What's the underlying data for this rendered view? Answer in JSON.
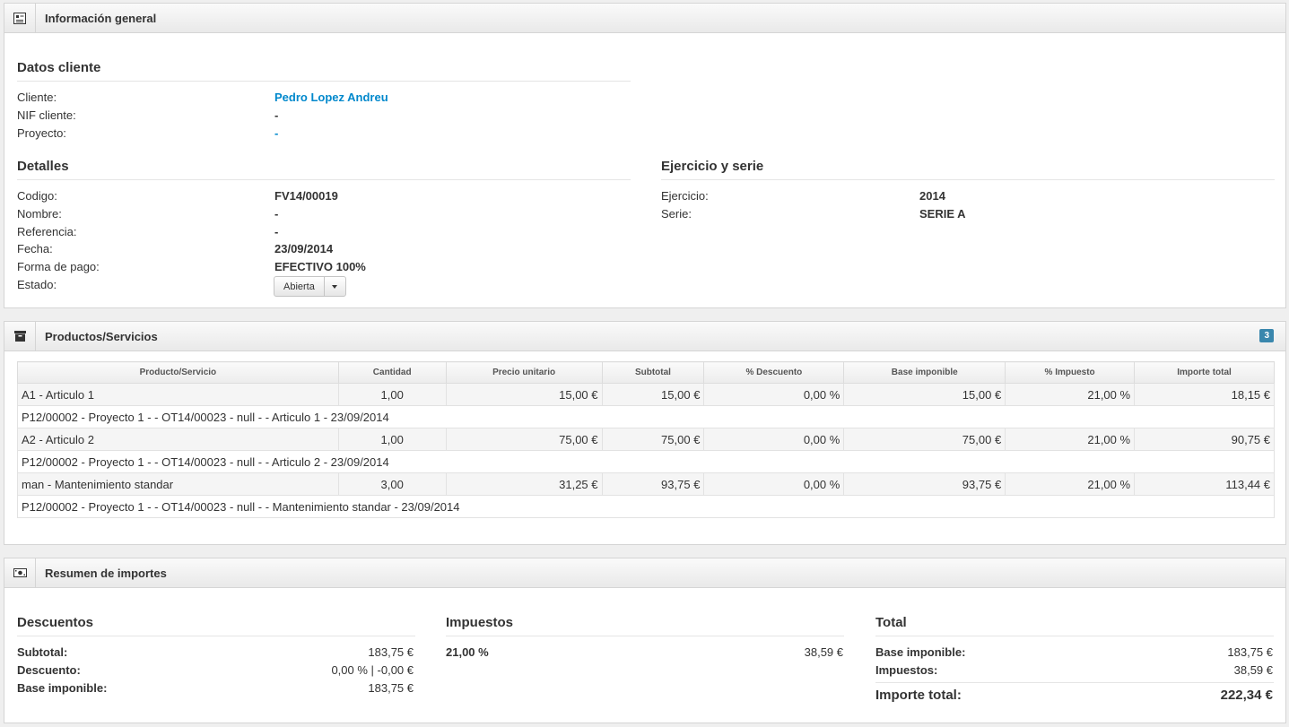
{
  "info": {
    "header": "Información general",
    "cliente_section": {
      "title": "Datos cliente",
      "rows": [
        {
          "label": "Cliente:",
          "value": "Pedro Lopez Andreu"
        },
        {
          "label": "NIF cliente:",
          "value": "-"
        },
        {
          "label": "Proyecto:",
          "value": "-"
        }
      ]
    },
    "detalles_section": {
      "title": "Detalles",
      "rows": [
        {
          "label": "Codigo:",
          "value": "FV14/00019"
        },
        {
          "label": "Nombre:",
          "value": "-"
        },
        {
          "label": "Referencia:",
          "value": "-"
        },
        {
          "label": "Fecha:",
          "value": "23/09/2014"
        },
        {
          "label": "Forma de pago:",
          "value": "EFECTIVO 100%"
        }
      ],
      "estado_label": "Estado:",
      "estado_value": "Abierta"
    },
    "ejercicio_section": {
      "title": "Ejercicio y serie",
      "rows": [
        {
          "label": "Ejercicio:",
          "value": "2014"
        },
        {
          "label": "Serie:",
          "value": "SERIE A"
        }
      ]
    }
  },
  "productos": {
    "header": "Productos/Servicios",
    "count": "3",
    "columns": [
      "Producto/Servicio",
      "Cantidad",
      "Precio unitario",
      "Subtotal",
      "% Descuento",
      "Base imponible",
      "% Impuesto",
      "Importe total"
    ],
    "rows": [
      {
        "producto": "A1 - Articulo 1",
        "cantidad": "1,00",
        "precio": "15,00 €",
        "subtotal": "15,00 €",
        "descuento": "0,00 %",
        "base": "15,00 €",
        "impuesto": "21,00 %",
        "total": "18,15 €",
        "detalle": "P12/00002 - Proyecto 1 - - OT14/00023 - null - - Articulo 1 - 23/09/2014"
      },
      {
        "producto": "A2 - Articulo 2",
        "cantidad": "1,00",
        "precio": "75,00 €",
        "subtotal": "75,00 €",
        "descuento": "0,00 %",
        "base": "75,00 €",
        "impuesto": "21,00 %",
        "total": "90,75 €",
        "detalle": "P12/00002 - Proyecto 1 - - OT14/00023 - null - - Articulo 2 - 23/09/2014"
      },
      {
        "producto": "man - Mantenimiento standar",
        "cantidad": "3,00",
        "precio": "31,25 €",
        "subtotal": "93,75 €",
        "descuento": "0,00 %",
        "base": "93,75 €",
        "impuesto": "21,00 %",
        "total": "113,44 €",
        "detalle": "P12/00002 - Proyecto 1 - - OT14/00023 - null - - Mantenimiento standar - 23/09/2014"
      }
    ]
  },
  "resumen": {
    "header": "Resumen de importes",
    "descuentos": {
      "title": "Descuentos",
      "rows": [
        {
          "label": "Subtotal:",
          "value": "183,75 €"
        },
        {
          "label": "Descuento:",
          "value": "0,00 % | -0,00 €"
        },
        {
          "label": "Base imponible:",
          "value": "183,75 €"
        }
      ]
    },
    "impuestos": {
      "title": "Impuestos",
      "rows": [
        {
          "label": "21,00 %",
          "value": "38,59 €"
        }
      ]
    },
    "total": {
      "title": "Total",
      "rows": [
        {
          "label": "Base imponible:",
          "value": "183,75 €"
        },
        {
          "label": "Impuestos:",
          "value": "38,59 €"
        }
      ],
      "grand_label": "Importe total:",
      "grand_value": "222,34 €"
    }
  }
}
